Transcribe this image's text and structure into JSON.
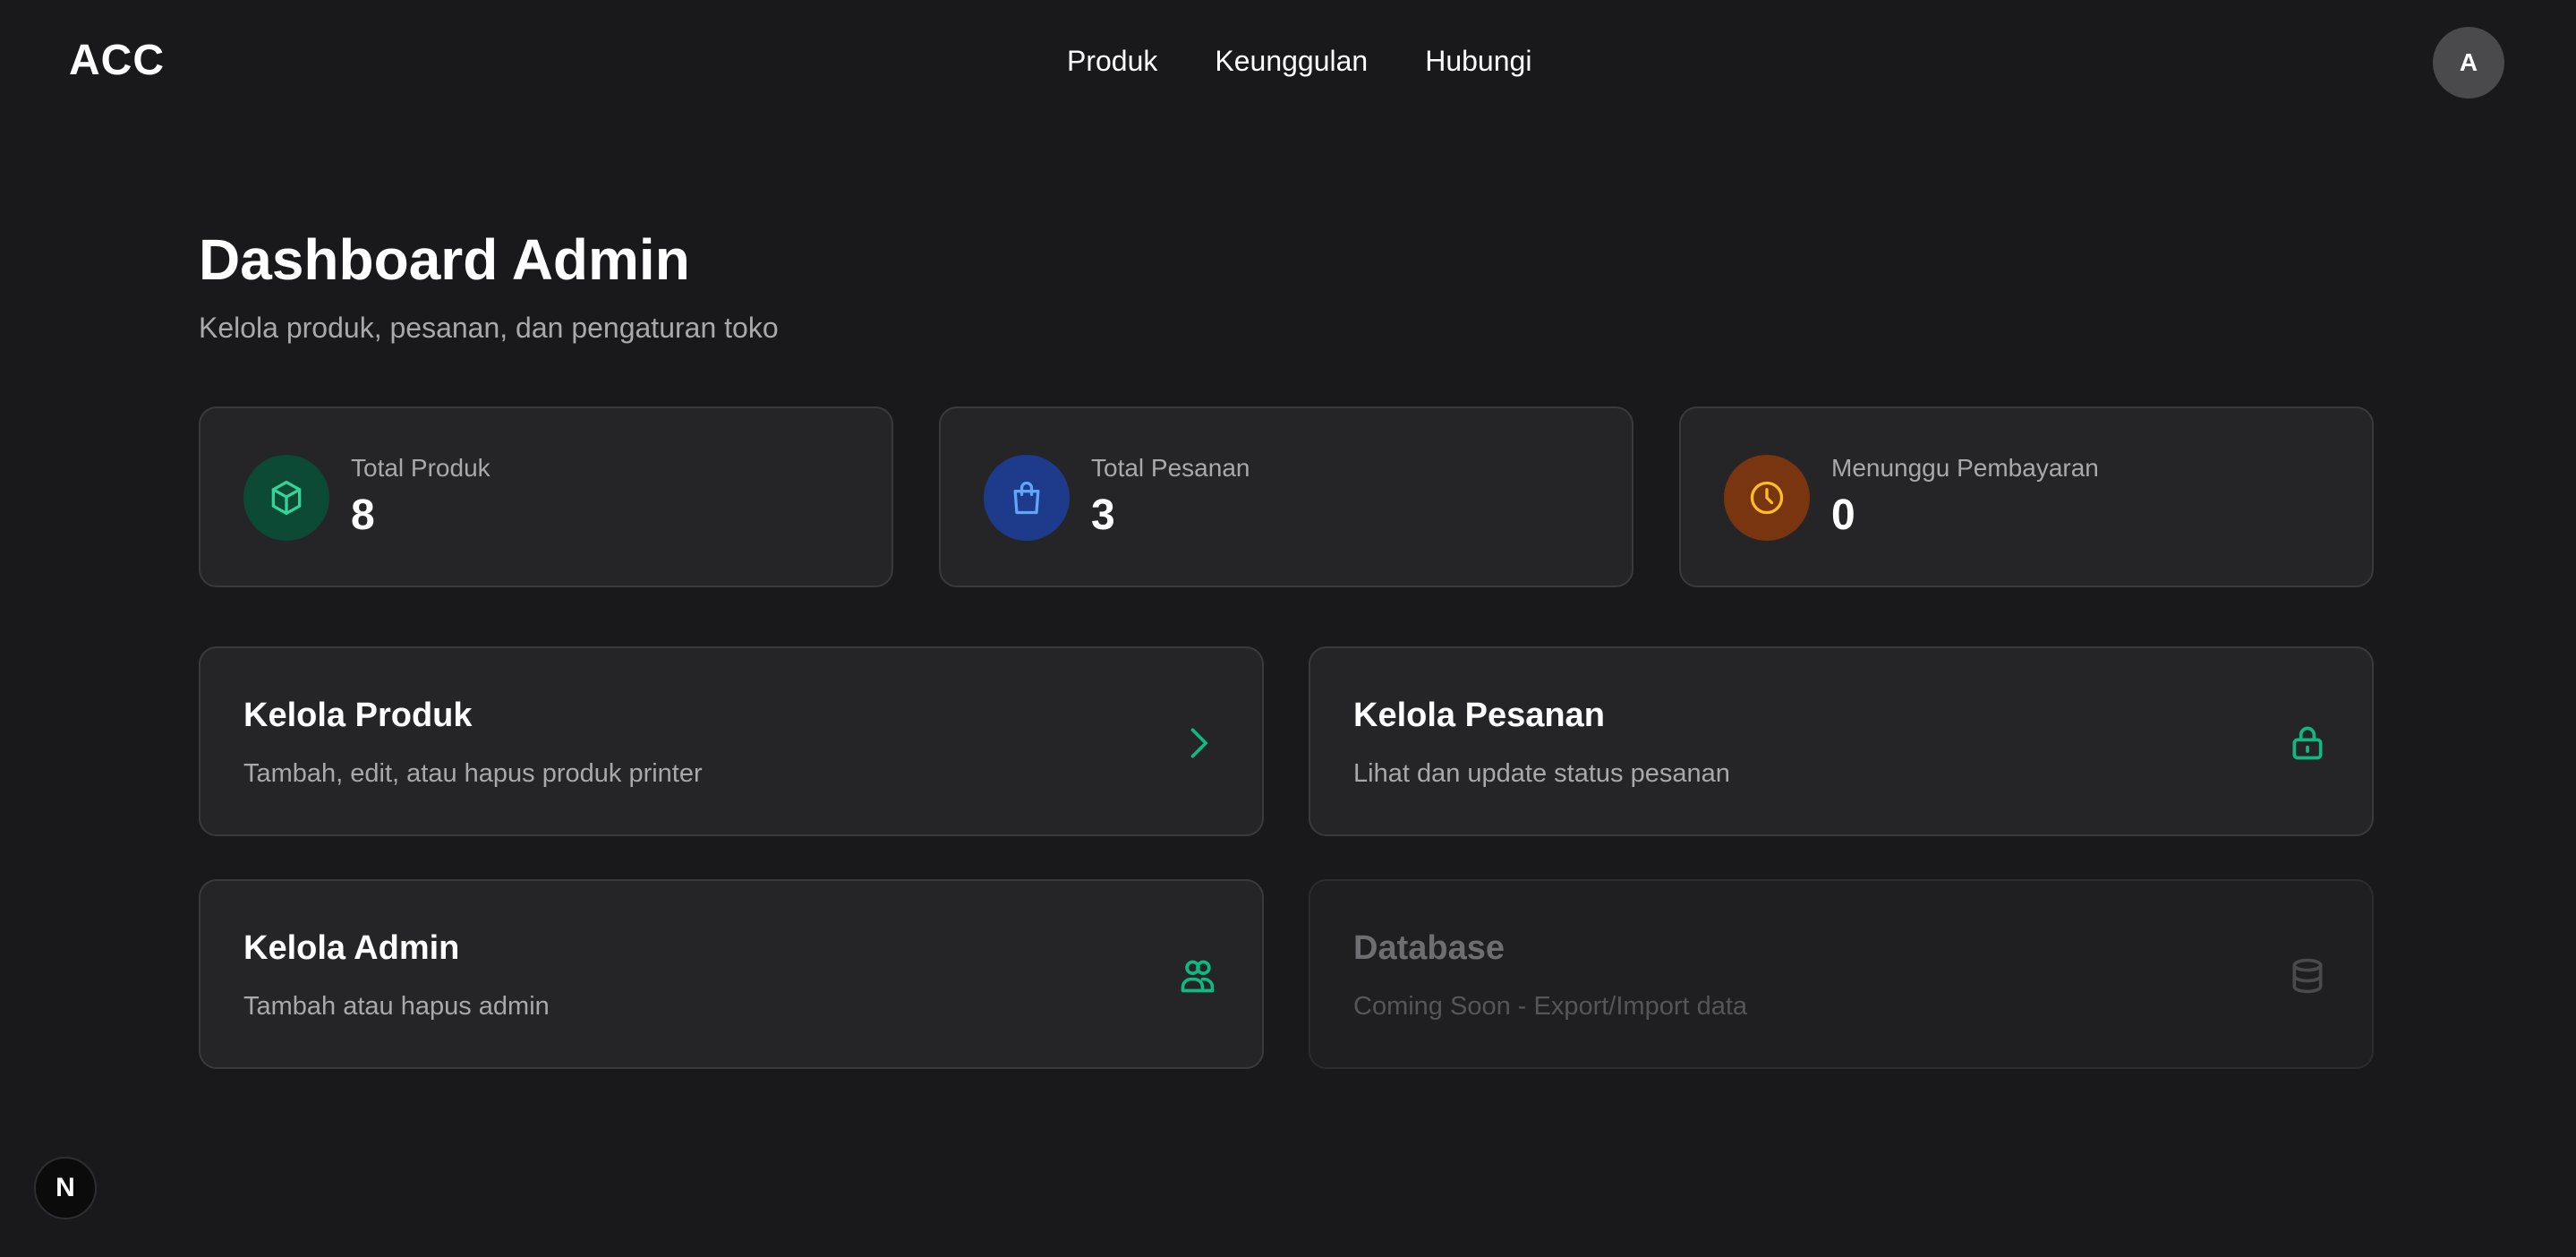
{
  "header": {
    "logo": "ACC",
    "nav": [
      "Produk",
      "Keunggulan",
      "Hubungi"
    ],
    "avatar_initial": "A"
  },
  "page": {
    "title": "Dashboard Admin",
    "subtitle": "Kelola produk, pesanan, dan pengaturan toko"
  },
  "stats": [
    {
      "label": "Total Produk",
      "value": "8",
      "icon": "cube-icon",
      "icon_bg": "#0d4a35",
      "icon_color": "#34d399"
    },
    {
      "label": "Total Pesanan",
      "value": "3",
      "icon": "shopping-bag-icon",
      "icon_bg": "#1e3a8a",
      "icon_color": "#60a5fa"
    },
    {
      "label": "Menunggu Pembayaran",
      "value": "0",
      "icon": "clock-icon",
      "icon_bg": "#78350f",
      "icon_color": "#fbbf24"
    }
  ],
  "actions": [
    {
      "title": "Kelola Produk",
      "description": "Tambah, edit, atau hapus produk printer",
      "icon": "chevron-right-icon"
    },
    {
      "title": "Kelola Pesanan",
      "description": "Lihat dan update status pesanan",
      "icon": "lock-icon"
    },
    {
      "title": "Kelola Admin",
      "description": "Tambah atau hapus admin",
      "icon": "users-icon"
    },
    {
      "title": "Database",
      "description": "Coming Soon - Export/Import data",
      "icon": "database-icon",
      "disabled": true
    }
  ],
  "accent_color": "#10b981",
  "dev_badge": "N"
}
